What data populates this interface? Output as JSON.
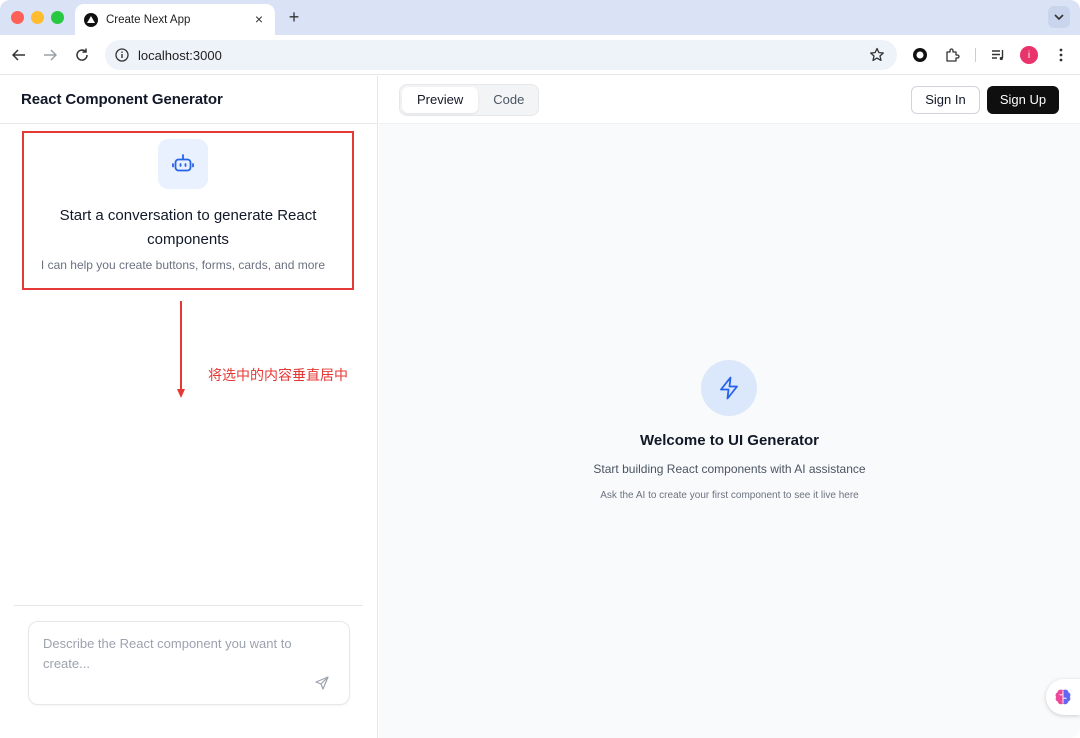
{
  "browser": {
    "tab_title": "Create Next App",
    "tab_close": "×",
    "new_tab": "+",
    "url": "localhost:3000",
    "profile_initial": "i"
  },
  "sidebar": {
    "app_title": "React Component Generator",
    "empty_state": {
      "title": "Start a conversation to generate React components",
      "subtitle": "I can help you create buttons, forms, cards, and more"
    },
    "annotation": "将选中的内容垂直居中",
    "prompt": {
      "placeholder": "Describe the React component you want to create..."
    }
  },
  "main": {
    "tabs": [
      {
        "label": "Preview",
        "active": true
      },
      {
        "label": "Code",
        "active": false
      }
    ],
    "sign_in": "Sign In",
    "sign_up": "Sign Up",
    "welcome": {
      "title": "Welcome to UI Generator",
      "subtitle": "Start building React components with AI assistance",
      "hint": "Ask the AI to create your first component to see it live here"
    }
  },
  "colors": {
    "annotation_red": "#e53935",
    "accent_blue": "#2563eb",
    "signup_bg": "#0f0f10",
    "profile_pink": "#e8336b"
  },
  "icons": [
    "nextjs-favicon-icon",
    "close-icon",
    "plus-icon",
    "chevron-down-icon",
    "back-icon",
    "forward-icon",
    "reload-icon",
    "info-icon",
    "star-icon",
    "record-icon",
    "extensions-icon",
    "media-icon",
    "more-icon",
    "bot-icon",
    "send-icon",
    "bolt-icon",
    "brain-icon"
  ]
}
